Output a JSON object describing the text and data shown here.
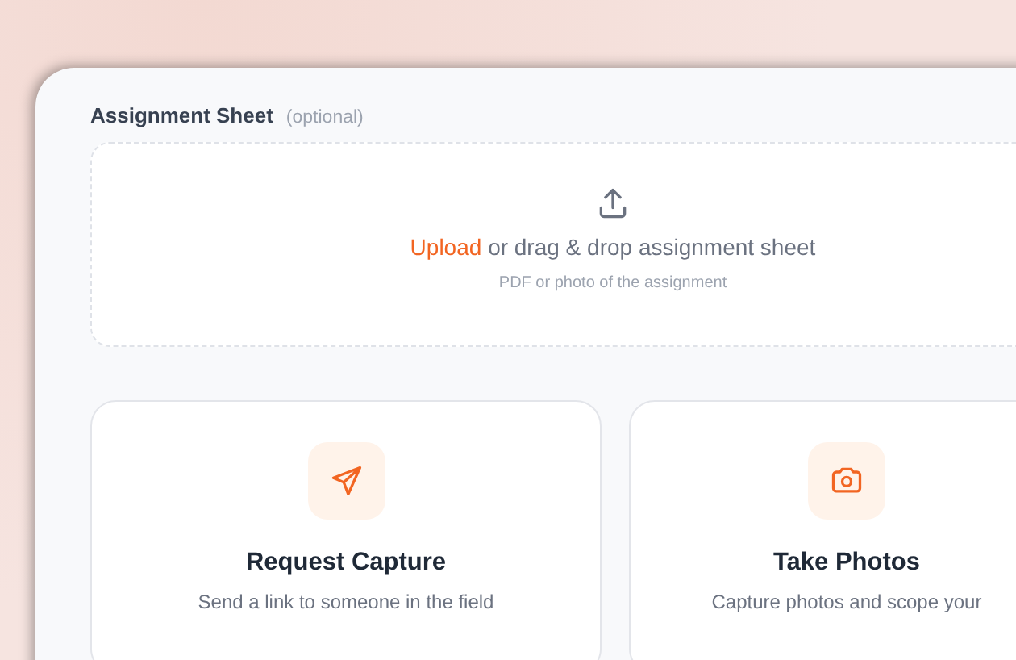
{
  "section": {
    "title": "Assignment Sheet",
    "hint": "(optional)"
  },
  "dropzone": {
    "link": "Upload",
    "text": "or drag & drop assignment sheet",
    "note": "PDF or photo of the assignment"
  },
  "options": [
    {
      "kind": "send",
      "title": "Request Capture",
      "description": "Send a link to someone in the field"
    },
    {
      "kind": "camera",
      "title": "Take Photos",
      "description": "Capture photos and scope your"
    }
  ]
}
